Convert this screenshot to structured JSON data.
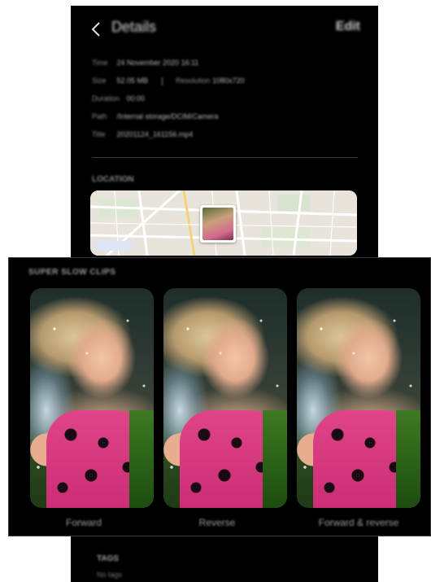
{
  "header": {
    "title": "Details",
    "edit_label": "Edit"
  },
  "details": {
    "time_label": "Time",
    "time_value": "24 November 2020 16:11",
    "size_label": "Size",
    "size_value": "52.05 MB",
    "resolution_label": "Resolution",
    "resolution_value": "1080x720",
    "duration_label": "Duration",
    "duration_value": "00:00",
    "path_label": "Path",
    "path_value": "/Internal storage/DCIM/Camera",
    "title_label": "Title",
    "title_value": "20201124_161156.mp4"
  },
  "location": {
    "label": "LOCATION"
  },
  "super_slow": {
    "label": "SUPER SLOW CLIPS",
    "clips": [
      {
        "label": "Forward"
      },
      {
        "label": "Reverse"
      },
      {
        "label": "Forward & reverse"
      }
    ]
  },
  "tags": {
    "label": "TAGS",
    "value": "No tags"
  },
  "colors": {
    "background": "#000000",
    "panel_border": "#3a3a3a",
    "text_muted": "#8a8a8a"
  }
}
